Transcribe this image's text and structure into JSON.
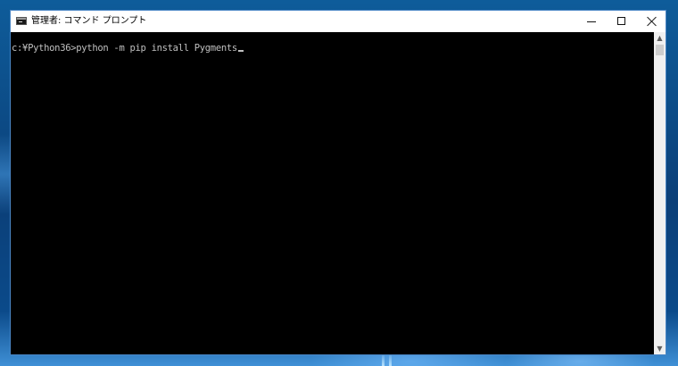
{
  "window": {
    "title": "管理者: コマンド プロンプト",
    "icon": "cmd-icon"
  },
  "titlebar_buttons": {
    "minimize": "minimize-icon",
    "maximize": "maximize-icon",
    "close": "close-icon"
  },
  "console": {
    "prompt": "c:¥Python36>",
    "command": "python -m pip install Pygments",
    "text_color": "#c0c0c0",
    "background": "#000000"
  },
  "scrollbar": {
    "up": "▲",
    "down": "▼"
  }
}
